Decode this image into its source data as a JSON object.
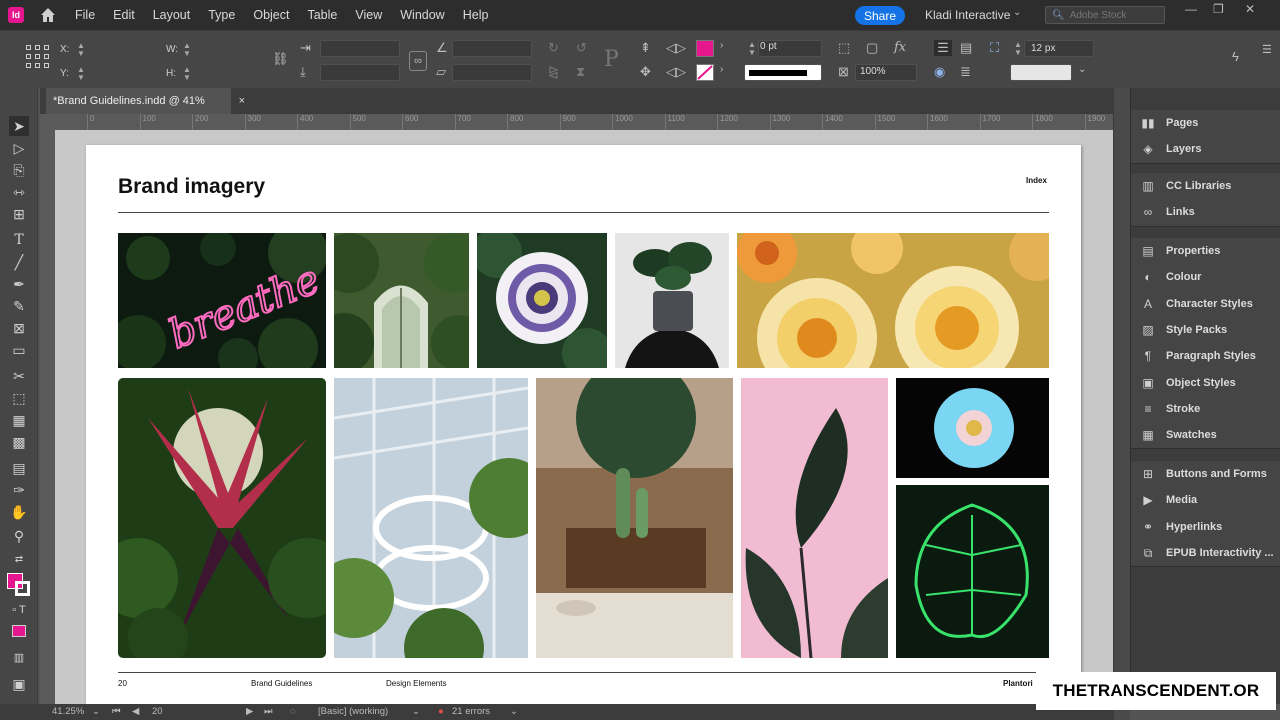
{
  "menubar": {
    "app_logo": "Id",
    "items": [
      "File",
      "Edit",
      "Layout",
      "Type",
      "Object",
      "Table",
      "View",
      "Window",
      "Help"
    ],
    "share_label": "Share",
    "org_name": "Kladi Interactive",
    "stock_search_placeholder": "Adobe Stock"
  },
  "controlbar": {
    "x_label": "X:",
    "y_label": "Y:",
    "w_label": "W:",
    "h_label": "H:",
    "stroke_weight": "0 pt",
    "zoom": "100%",
    "point_size": "12 px",
    "colors": {
      "fill": "#e6178e",
      "stroke": "#000000"
    }
  },
  "tab": {
    "title": "*Brand Guidelines.indd @ 41%",
    "close": "×"
  },
  "ruler": {
    "ticks": [
      "0",
      "100",
      "200",
      "300",
      "400",
      "500",
      "600",
      "700",
      "800",
      "900",
      "1000",
      "1100",
      "1200",
      "1300",
      "1400",
      "1500",
      "1600",
      "1700",
      "1800",
      "1900"
    ]
  },
  "page": {
    "title": "Brand imagery",
    "index_label": "Index",
    "footer": {
      "page_number": "20",
      "doc_name": "Brand Guidelines",
      "section": "Design Elements",
      "brand": "Plantori"
    }
  },
  "images": [
    {
      "name": "neon-breathe",
      "neon_text": "breathe"
    },
    {
      "name": "greenhouse-arches"
    },
    {
      "name": "passion-flower"
    },
    {
      "name": "person-holding-plant"
    },
    {
      "name": "yellow-flowers"
    },
    {
      "name": "tropical-plant"
    },
    {
      "name": "spiral-staircase"
    },
    {
      "name": "cactus-chair"
    },
    {
      "name": "rubber-plant-pink"
    },
    {
      "name": "blue-flower"
    },
    {
      "name": "neon-monstera"
    }
  ],
  "statusbar": {
    "zoom": "41.25%",
    "page": "20",
    "style": "[Basic] (working)",
    "errors": "21 errors"
  },
  "panel": {
    "groups": [
      [
        "Pages",
        "Layers"
      ],
      [
        "CC Libraries",
        "Links"
      ],
      [
        "Properties",
        "Colour",
        "Character Styles",
        "Style Packs",
        "Paragraph Styles",
        "Object Styles",
        "Stroke",
        "Swatches"
      ],
      [
        "Buttons and Forms",
        "Media",
        "Hyperlinks",
        "EPUB Interactivity ..."
      ]
    ],
    "icons": [
      [
        "pages-icon",
        "layers-icon"
      ],
      [
        "cc-libraries-icon",
        "links-icon"
      ],
      [
        "properties-icon",
        "colour-icon",
        "character-styles-icon",
        "style-packs-icon",
        "paragraph-styles-icon",
        "object-styles-icon",
        "stroke-icon",
        "swatches-icon"
      ],
      [
        "buttons-forms-icon",
        "media-icon",
        "hyperlinks-icon",
        "epub-interactivity-icon"
      ]
    ]
  },
  "watermark": "THETRANSCENDENT.OR"
}
